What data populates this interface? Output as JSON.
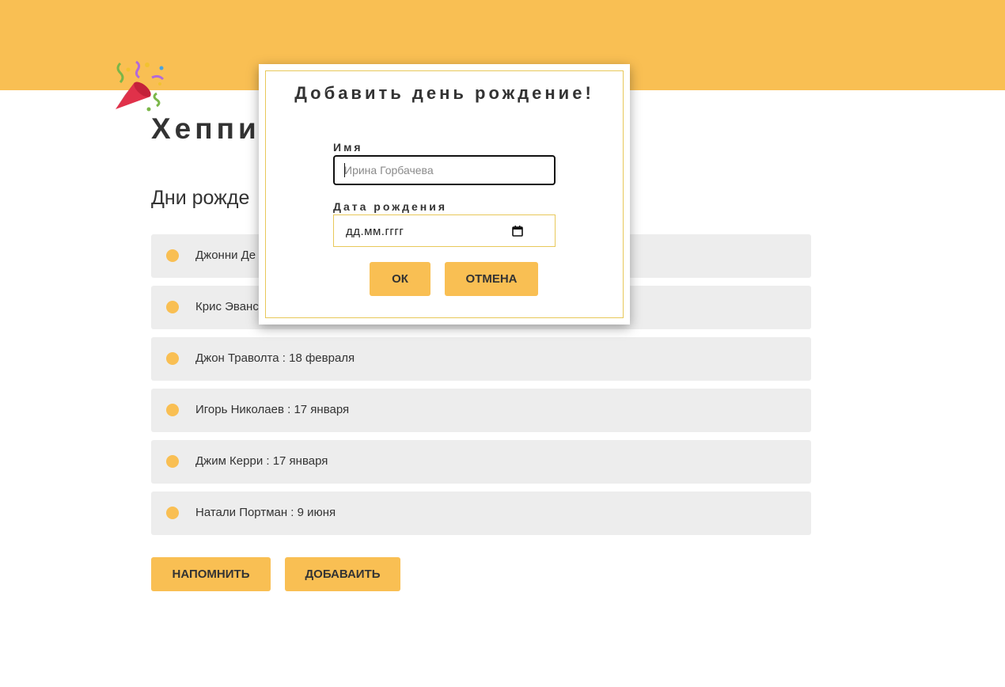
{
  "app": {
    "title": "Хеппи",
    "icon": "party-popper-icon",
    "accent_color": "#f9bf53"
  },
  "section": {
    "title": "Дни рожде"
  },
  "birthdays": [
    {
      "text": "Джонни Де"
    },
    {
      "text": "Крис Эванс"
    },
    {
      "text": "Джон Траволта : 18 февраля"
    },
    {
      "text": "Игорь Николаев : 17 января"
    },
    {
      "text": "Джим Керри : 17 января"
    },
    {
      "text": "Натали Портман : 9 июня"
    }
  ],
  "actions": {
    "remind_label": "НАПОМНИТЬ",
    "add_label": "ДОБАВАИТЬ"
  },
  "modal": {
    "title": "Добавить день рождение!",
    "name_label": "Имя",
    "name_placeholder": "Ирина Горбачева",
    "name_value": "",
    "date_label": "Дата рождения",
    "date_placeholder": "дд.мм.гггг",
    "ok_label": "ОК",
    "cancel_label": "ОТМЕНА"
  }
}
